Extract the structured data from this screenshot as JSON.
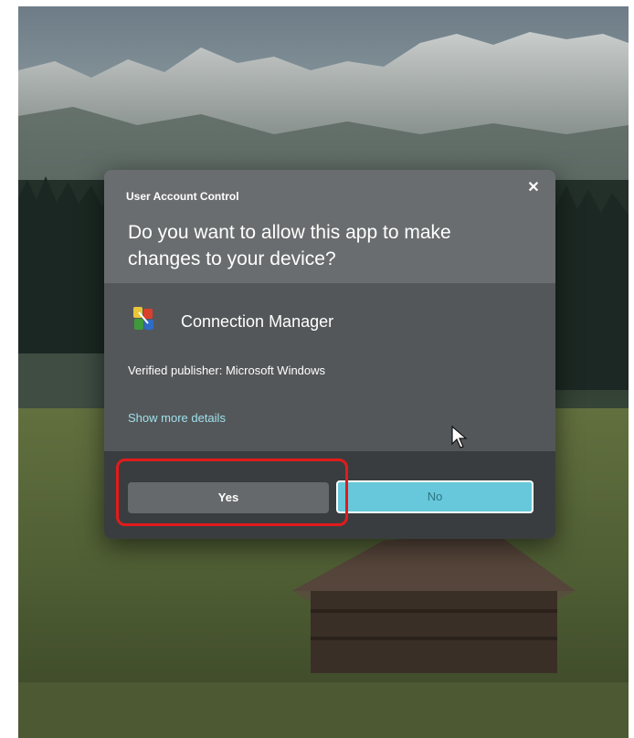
{
  "dialog": {
    "caption": "User Account Control",
    "question": "Do you want to allow this app to make changes to your device?",
    "app_name": "Connection Manager",
    "publisher": "Verified publisher: Microsoft Windows",
    "details_link": "Show more details",
    "yes_label": "Yes",
    "no_label": "No",
    "close_glyph": "✕"
  },
  "icons": {
    "close": "close-icon",
    "app": "connection-manager-icon",
    "cursor": "mouse-pointer-icon"
  },
  "colors": {
    "no_button": "#66c8da",
    "yes_button": "#66696b",
    "link": "#9fe0ec",
    "highlight": "#e21b1b"
  }
}
